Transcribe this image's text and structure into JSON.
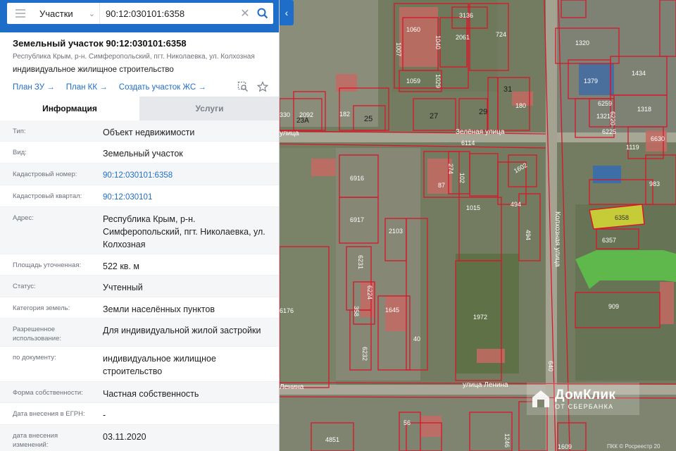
{
  "search": {
    "type_label": "Участки",
    "query": "90:12:030101:6358"
  },
  "header": {
    "title": "Земельный участок 90:12:030101:6358",
    "address_small": "Республика Крым, р-н. Симферопольский, пгт. Николаевка, ул. Колхозная",
    "purpose": "индивидуальное жилищное строительство",
    "links": [
      "План ЗУ",
      "План КК",
      "Создать участок ЖС"
    ]
  },
  "tabs": [
    "Информация",
    "Услуги"
  ],
  "rows": [
    {
      "label": "Тип:",
      "value": "Объект недвижимости"
    },
    {
      "label": "Вид:",
      "value": "Земельный участок"
    },
    {
      "label": "Кадастровый номер:",
      "value": "90:12:030101:6358"
    },
    {
      "label": "Кадастровый квартал:",
      "value": "90:12:030101"
    },
    {
      "label": "Адрес:",
      "value": "Республика Крым, р-н. Симферопольский, пгт. Николаевка, ул. Колхозная"
    },
    {
      "label": "Площадь уточненная:",
      "value": "522 кв. м"
    },
    {
      "label": "Статус:",
      "value": "Учтенный"
    },
    {
      "label": "Категория земель:",
      "value": "Земли населённых пунктов"
    },
    {
      "label": "Разрешенное использование:",
      "value": "Для индивидуальной жилой застройки"
    },
    {
      "label": "по документу:",
      "value": "индивидуальное жилищное строительство"
    },
    {
      "label": "Форма собственности:",
      "value": "Частная собственность"
    },
    {
      "label": "Дата внесения в ЕГРН:",
      "value": "-"
    },
    {
      "label": "дата внесения изменений:",
      "value": "03.11.2020"
    }
  ],
  "map": {
    "streets": [
      "Зелёная улица",
      "Колхозная улица",
      "улица Ленина",
      "Ленина",
      "улица"
    ],
    "parcel_labels": [
      "1060",
      "1040",
      "2061",
      "3136",
      "724",
      "1059",
      "1029",
      "1320",
      "1379",
      "1434",
      "31",
      "180",
      "27",
      "29",
      "182",
      "25",
      "2092",
      "23А",
      "1321",
      "1318",
      "6259",
      "6220",
      "6225",
      "6630",
      "1119",
      "6114",
      "6916",
      "274",
      "102",
      "87",
      "1602",
      "983",
      "1015",
      "494",
      "6358",
      "6357",
      "6917",
      "2103",
      "494",
      "6231",
      "6224",
      "1645",
      "358",
      "909",
      "1972",
      "6176",
      "40",
      "6232",
      "640",
      "56",
      "4851",
      "1246",
      "1609"
    ],
    "selected_parcel": "6358",
    "watermark_brand": "ДомКлик",
    "watermark_sub": "ОТ СБЕРБАНКА",
    "copyright": "ПКК © Росреестр 20",
    "colors": {
      "boundary": "#d8162a",
      "selected_fill": "#e6ea2e",
      "green_zone": "#5ec04a",
      "accent": "#1e6ec9"
    }
  }
}
